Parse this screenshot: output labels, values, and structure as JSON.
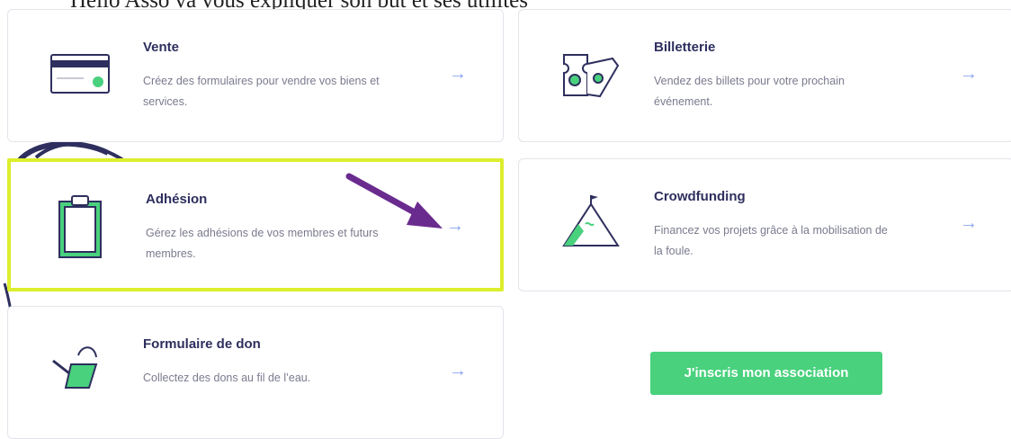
{
  "caption": "Hello Asso va vous expliquer son but et ses utilités",
  "cards": [
    {
      "title": "Vente",
      "desc": "Créez des formulaires pour vendre vos biens et services.",
      "arrow": "→"
    },
    {
      "title": "Billetterie",
      "desc": "Vendez des billets pour votre prochain événement.",
      "arrow": "→"
    },
    {
      "title": "Adhésion",
      "desc": "Gérez les adhésions de vos membres et futurs membres.",
      "arrow": "→"
    },
    {
      "title": "Crowdfunding",
      "desc": "Financez vos projets grâce à la mobilisation de la foule.",
      "arrow": "→"
    },
    {
      "title": "Formulaire de don",
      "desc": "Collectez des dons au fil de l’eau.",
      "arrow": "→"
    }
  ],
  "cta": {
    "label": "J'inscris mon association"
  },
  "colors": {
    "accent": "#49d17d",
    "title": "#2e2f5e",
    "highlight": "#dcee2d",
    "annotation": "#6a2b8f",
    "arrow": "#8aa4f0"
  },
  "icons": [
    "credit-card-icon",
    "tickets-icon",
    "clipboard-icon",
    "mountain-flag-icon",
    "watering-can-icon"
  ]
}
